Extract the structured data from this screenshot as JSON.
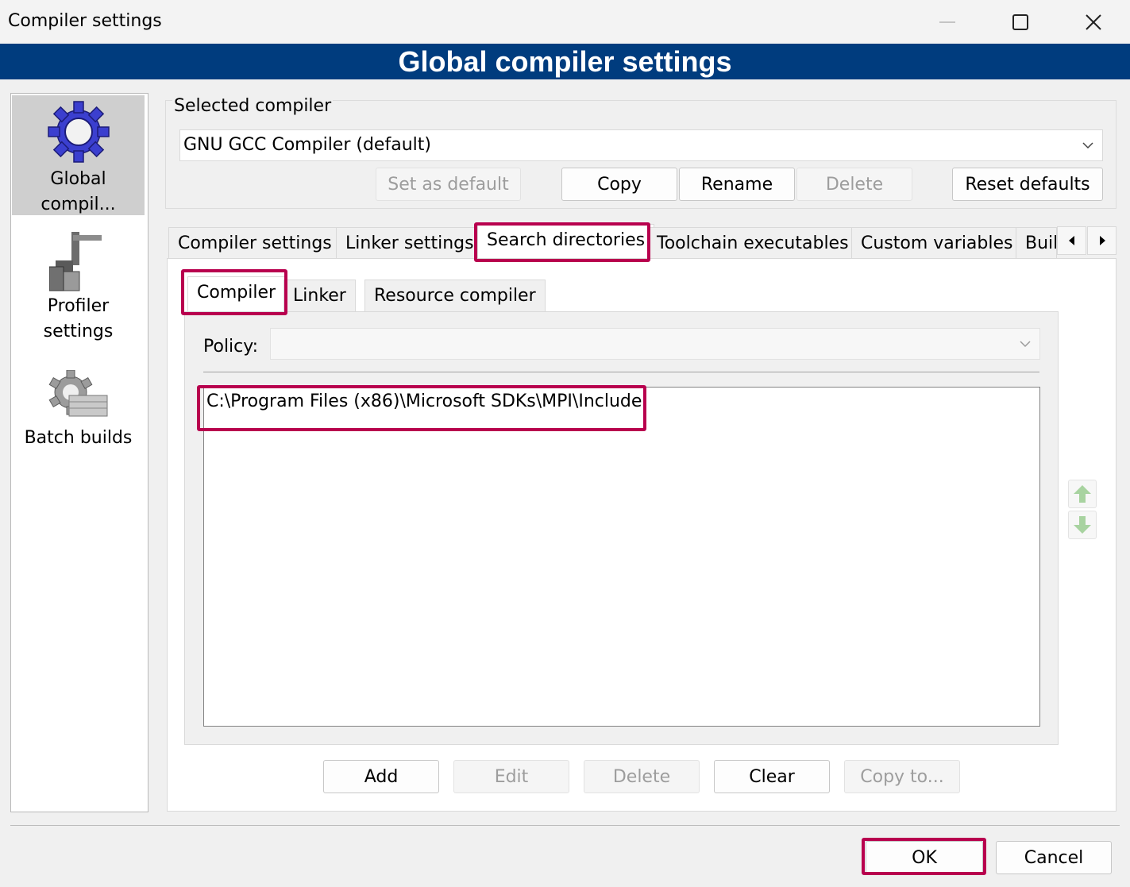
{
  "window": {
    "title": "Compiler settings",
    "minimize_icon": "minimize-icon",
    "maximize_icon": "maximize-icon",
    "close_icon": "close-icon"
  },
  "banner": "Global compiler settings",
  "sidebar": {
    "items": [
      {
        "label": "Global compil...",
        "icon": "gear-icon",
        "selected": true
      },
      {
        "label": "Profiler settings",
        "icon": "profiler-icon"
      },
      {
        "label": "Batch builds",
        "icon": "batch-gear-icon"
      }
    ]
  },
  "selected_compiler": {
    "label": "Selected compiler",
    "value": "GNU GCC Compiler (default)",
    "buttons": {
      "set_default": "Set as default",
      "copy": "Copy",
      "rename": "Rename",
      "delete": "Delete",
      "reset": "Reset defaults"
    }
  },
  "tabs": [
    "Compiler settings",
    "Linker settings",
    "Search directories",
    "Toolchain executables",
    "Custom variables",
    "Buil"
  ],
  "active_tab": "Search directories",
  "subtabs": [
    "Compiler",
    "Linker",
    "Resource compiler"
  ],
  "active_subtab": "Compiler",
  "policy": {
    "label": "Policy:",
    "value": ""
  },
  "directories": [
    "C:\\Program Files (x86)\\Microsoft SDKs\\MPI\\Include"
  ],
  "list_buttons": {
    "add": "Add",
    "edit": "Edit",
    "delete": "Delete",
    "clear": "Clear",
    "copy_to": "Copy to..."
  },
  "dialog_buttons": {
    "ok": "OK",
    "cancel": "Cancel"
  },
  "colors": {
    "banner": "#003c7e",
    "highlight": "#b8004e"
  }
}
